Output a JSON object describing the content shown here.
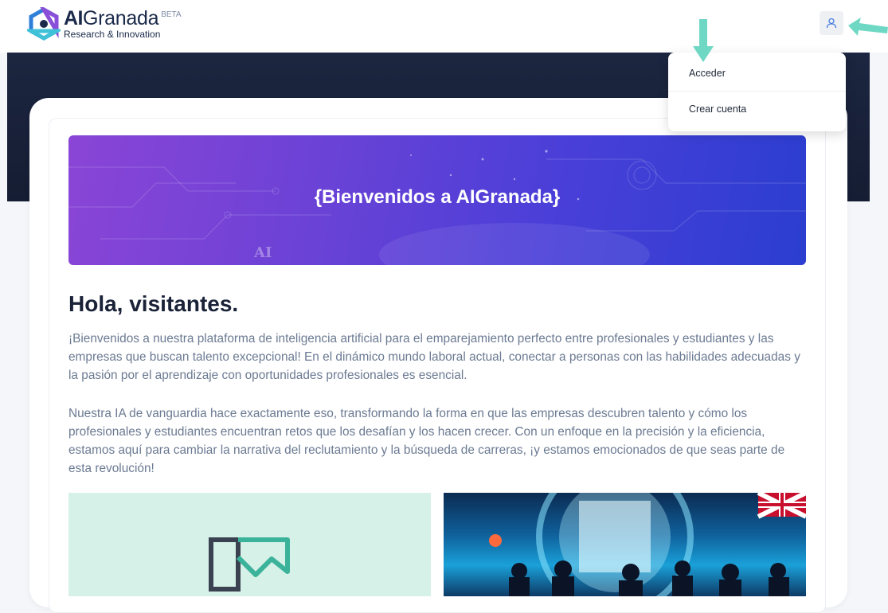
{
  "header": {
    "logo": {
      "ai": "AI",
      "granada": "Granada",
      "beta": "BETA",
      "subtitle": "Research & Innovation"
    },
    "user_icon": "user-icon"
  },
  "menu": {
    "items": [
      {
        "label": "Acceder"
      },
      {
        "label": "Crear cuenta"
      }
    ]
  },
  "banner": {
    "title": "{Bienvenidos a AIGranada}",
    "ai_mark": "AI"
  },
  "main": {
    "heading": "Hola, visitantes.",
    "paragraphs": [
      "¡Bienvenidos a nuestra plataforma de inteligencia artificial para el emparejamiento perfecto entre profesionales y estudiantes y las empresas que buscan talento excepcional! En el dinámico mundo laboral actual, conectar a personas con las habilidades adecuadas y la pasión por el aprendizaje con oportunidades profesionales es esencial.",
      "Nuestra IA de vanguardia hace exactamente eso, transformando la forma en que las empresas descubren talento y cómo los profesionales y estudiantes encuentran retos que los desafían y los hacen crecer. Con un enfoque en la precisión y la eficiencia, estamos aquí para cambiar la narrativa del reclutamiento y la búsqueda de carreras, ¡y estamos emocionados de que seas parte de esta revolución!"
    ]
  },
  "colors": {
    "accent_arrow": "#6fd8c4",
    "dark_band": "#1c2640",
    "banner_start": "#8a45d6",
    "banner_end": "#2b3ed0",
    "tile_left_bg": "#d6f1e8"
  }
}
